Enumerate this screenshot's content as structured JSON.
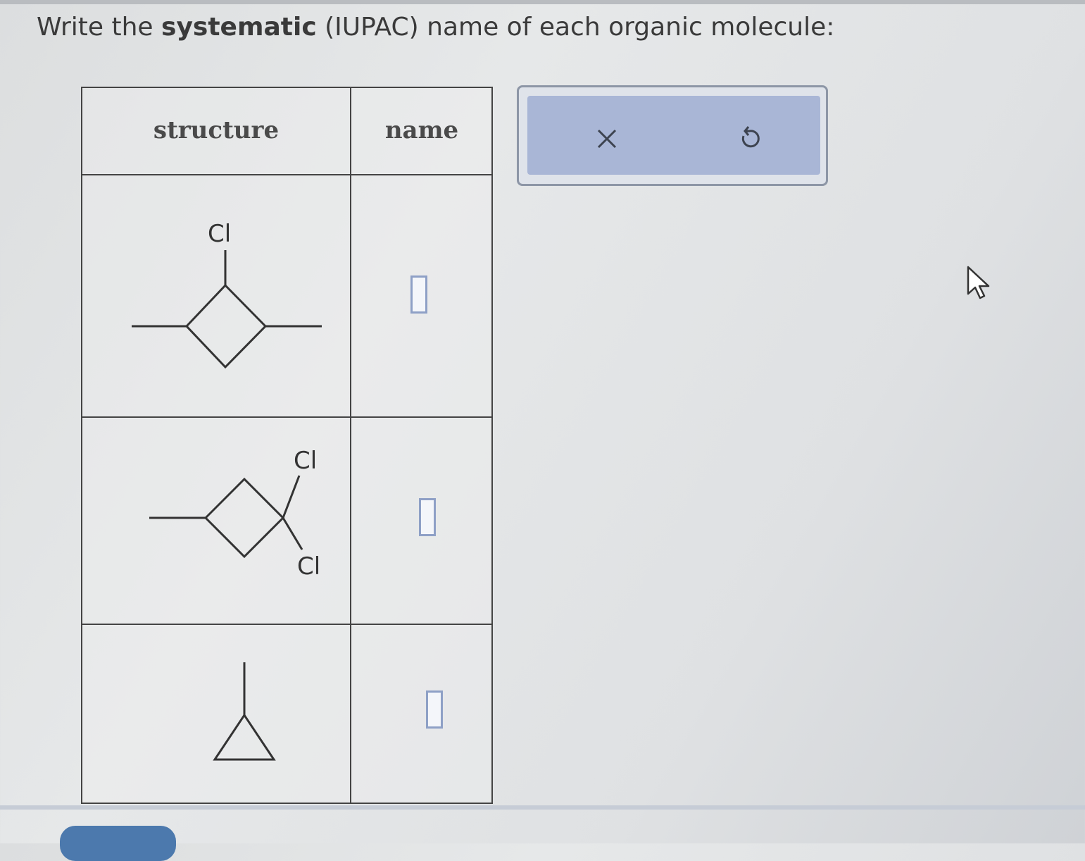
{
  "prompt": {
    "pre": "Write the ",
    "bold": "systematic",
    "post": " (IUPAC) name of each organic molecule:"
  },
  "table": {
    "headers": {
      "structure": "structure",
      "name": "name"
    },
    "rows": [
      {
        "molecule": "1-chloro ring drawing",
        "atom_labels": [
          "Cl"
        ],
        "answer": ""
      },
      {
        "molecule": "dichloro ring drawing",
        "atom_labels": [
          "Cl",
          "Cl"
        ],
        "answer": ""
      },
      {
        "molecule": "cyclopropane drawing",
        "atom_labels": [],
        "answer": ""
      }
    ]
  },
  "toolbar": {
    "clear_icon": "x-icon",
    "undo_icon": "undo-icon",
    "accent": "#a9b6d6"
  }
}
